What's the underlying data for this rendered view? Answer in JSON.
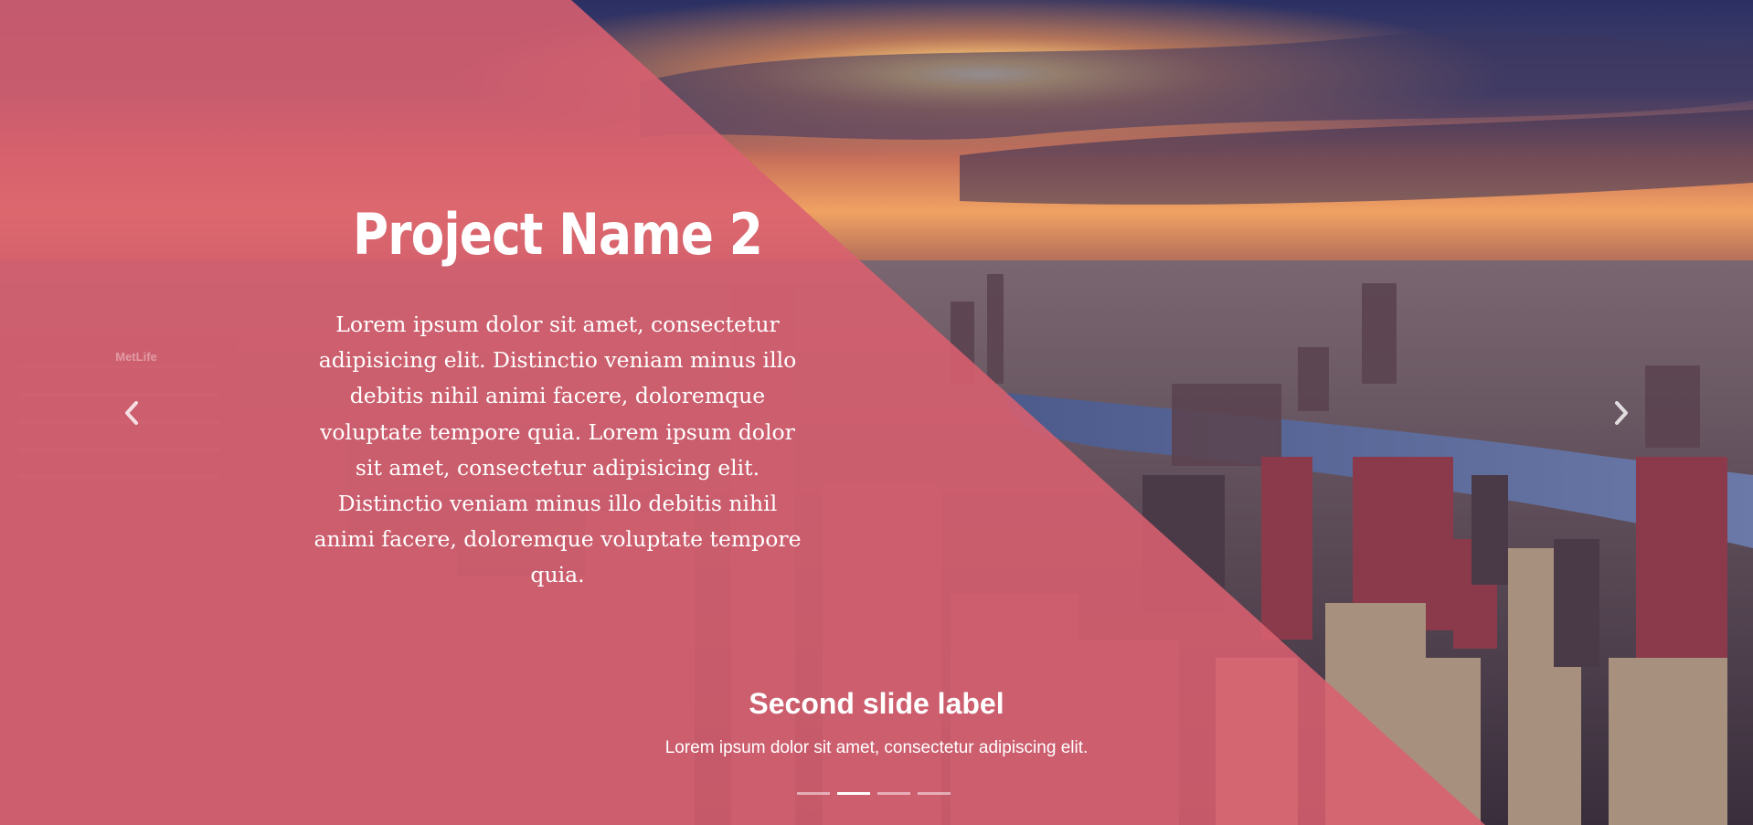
{
  "slide": {
    "project_title": "Project Name 2",
    "project_description": "Lorem ipsum dolor sit amet, consectetur adipisicing elit. Distinctio veniam minus illo debitis nihil animi facere, doloremque voluptate tempore quia. Lorem ipsum dolor sit amet, consectetur adipisicing elit. Distinctio veniam minus illo debitis nihil animi facere, doloremque voluptate tempore quia.",
    "caption_title": "Second slide label",
    "caption_text": "Lorem ipsum dolor sit amet, consectetur adipiscing elit.",
    "building_sign": "MetLife"
  },
  "controls": {
    "prev_icon": "chevron-left-icon",
    "next_icon": "chevron-right-icon"
  },
  "indicators": {
    "count": 4,
    "active_index": 1
  },
  "colors": {
    "overlay": "#d9606f",
    "sky_top": "#2d3263",
    "sun": "#ffd27a",
    "river": "#5a6a9c",
    "text": "#ffffff"
  }
}
